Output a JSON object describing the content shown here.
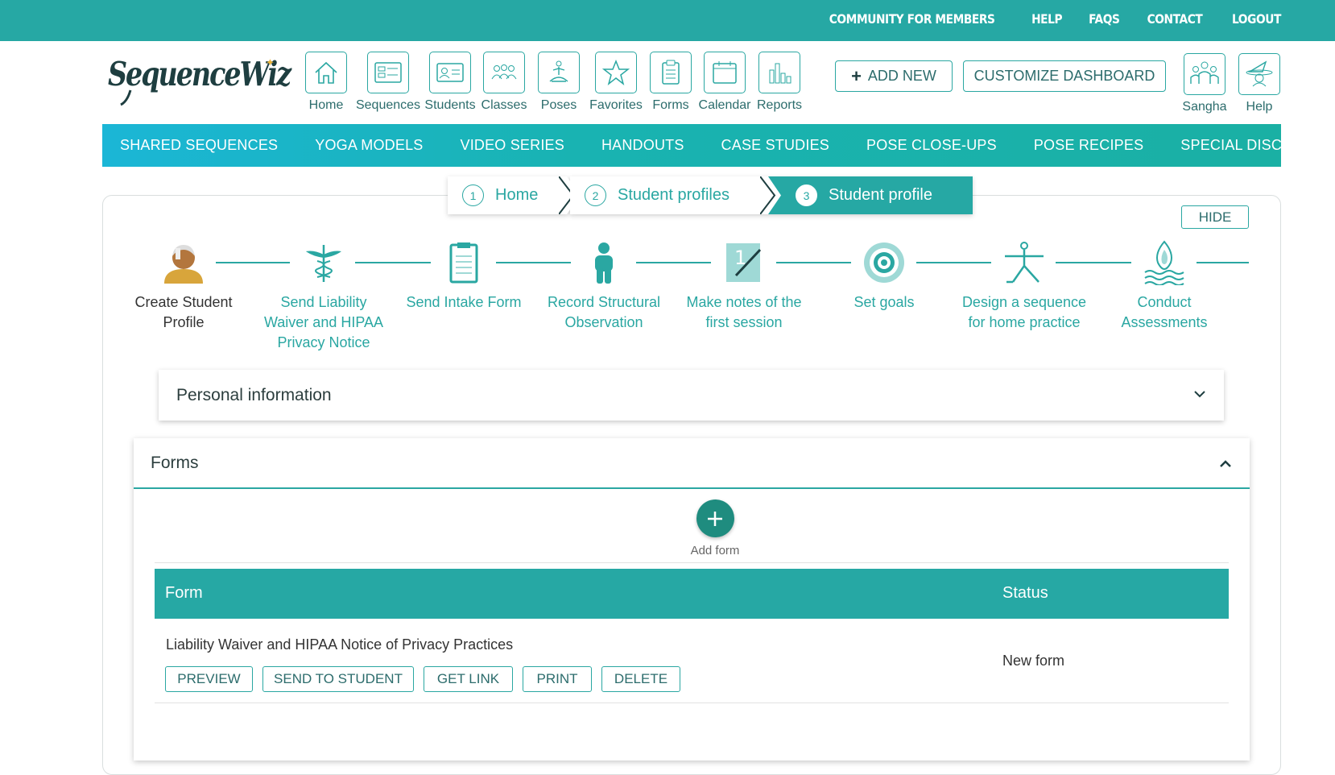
{
  "top_links": [
    "COMMUNITY FOR MEMBERS",
    "HELP",
    "FAQS",
    "CONTACT",
    "LOGOUT"
  ],
  "logo": {
    "text": "SequenceWiz"
  },
  "nav": [
    {
      "label": "Home",
      "icon": "house-icon"
    },
    {
      "label": "Sequences",
      "icon": "sequences-icon"
    },
    {
      "label": "Students",
      "icon": "id-card-icon"
    },
    {
      "label": "Classes",
      "icon": "people-group-icon"
    },
    {
      "label": "Poses",
      "icon": "meditation-pose-icon"
    },
    {
      "label": "Favorites",
      "icon": "star-icon"
    },
    {
      "label": "Forms",
      "icon": "clipboard-icon"
    },
    {
      "label": "Calendar",
      "icon": "calendar-icon"
    },
    {
      "label": "Reports",
      "icon": "bar-chart-icon"
    }
  ],
  "actions": {
    "add_new": "ADD NEW",
    "customize": "CUSTOMIZE DASHBOARD"
  },
  "right_nav": [
    {
      "label": "Sangha",
      "icon": "community-icon"
    },
    {
      "label": "Help",
      "icon": "wizard-icon"
    }
  ],
  "banner": [
    "SHARED SEQUENCES",
    "YOGA MODELS",
    "VIDEO SERIES",
    "HANDOUTS",
    "CASE STUDIES",
    "POSE CLOSE-UPS",
    "POSE RECIPES",
    "SPECIAL DISCOUNTS"
  ],
  "breadcrumb": [
    {
      "num": "1",
      "label": "Home"
    },
    {
      "num": "2",
      "label": "Student profiles"
    },
    {
      "num": "3",
      "label": "Student profile"
    }
  ],
  "hide_label": "HIDE",
  "steps": [
    {
      "line1": "Create Student",
      "line2": "Profile",
      "line3": "",
      "icon": "student-avatar-icon"
    },
    {
      "line1": "Send Liability",
      "line2": "Waiver and HIPAA",
      "line3": "Privacy Notice",
      "icon": "caduceus-icon"
    },
    {
      "line1": "Send Intake Form",
      "line2": "",
      "line3": "",
      "icon": "clipboard-icon"
    },
    {
      "line1": "Record Structural",
      "line2": "Observation",
      "line3": "",
      "icon": "person-icon"
    },
    {
      "line1": "Make notes of the",
      "line2": "first session",
      "line3": "",
      "icon": "notes-pencil-icon"
    },
    {
      "line1": "Set goals",
      "line2": "",
      "line3": "",
      "icon": "target-icon"
    },
    {
      "line1": "Design a sequence",
      "line2": "for home practice",
      "line3": "",
      "icon": "warrior-pose-icon"
    },
    {
      "line1": "Conduct",
      "line2": "Assessments",
      "line3": "",
      "icon": "flame-water-icon"
    }
  ],
  "personal_info": {
    "title": "Personal information"
  },
  "forms": {
    "title": "Forms",
    "add_label": "Add form",
    "col_form": "Form",
    "col_status": "Status",
    "rows": [
      {
        "title": "Liability Waiver and HIPAA Notice of Privacy Practices",
        "status": "New form",
        "buttons": [
          "PREVIEW",
          "SEND TO STUDENT",
          "GET LINK",
          "PRINT",
          "DELETE"
        ]
      }
    ]
  },
  "colors": {
    "teal": "#26a8a4",
    "dark_teal": "#1f8c7f",
    "text_teal": "#2c6c6c"
  }
}
